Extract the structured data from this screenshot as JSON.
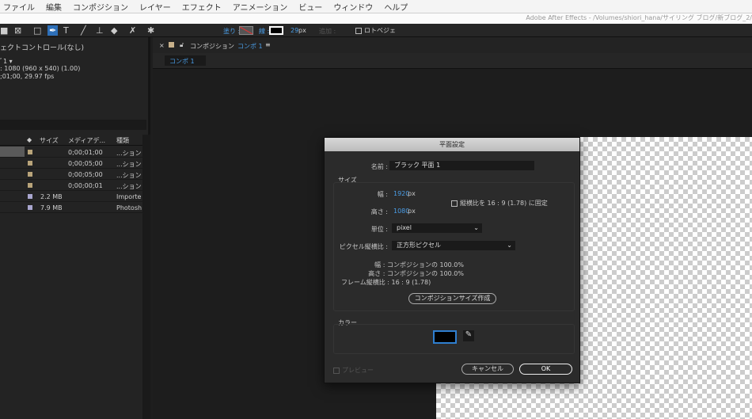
{
  "menu": [
    "ファイル",
    "編集",
    "コンポジション",
    "レイヤー",
    "エフェクト",
    "アニメーション",
    "ビュー",
    "ウィンドウ",
    "ヘルプ"
  ],
  "window_title": "Adobe After Effects - /Volumes/shiori_hana/サイリング ブログ/新ブログ_2/",
  "toolbar": {
    "fill_label": "塗り :",
    "stroke_label": "線 :",
    "stroke_width": "29",
    "stroke_unit": "px",
    "add_label": "追加 :",
    "rotobezier_label": "ロトベジェ"
  },
  "left_panel": {
    "title": "ェクトコントロール(なし)",
    "comp_name": "ﾞ1 ▾",
    "info1": ": 1080  (960 x 540) (1.00)",
    "info2": ";01;00, 29.97 fps",
    "columns": [
      "サイズ",
      "メディアデ...",
      "種類"
    ],
    "rows": [
      {
        "size": "",
        "dur": "0;00;01;00",
        "type": "...ション",
        "color": "#b9a47a"
      },
      {
        "size": "",
        "dur": "0;00;05;00",
        "type": "...ション",
        "color": "#b9a47a"
      },
      {
        "size": "",
        "dur": "0;00;05;00",
        "type": "...ション",
        "color": "#b9a47a"
      },
      {
        "size": "",
        "dur": "0;00;00;01",
        "type": "...ション",
        "color": "#b9a47a"
      },
      {
        "size": "2.2 MB",
        "dur": "",
        "type": "Importe",
        "color": "#a9a6cf"
      },
      {
        "size": "7.9 MB",
        "dur": "",
        "type": "Photosh",
        "color": "#a9a6cf"
      }
    ]
  },
  "comp_panel": {
    "close": "×",
    "label": "コンポジション",
    "comp": "コンポ 1",
    "menu": "≡",
    "tab": "コンポ 1"
  },
  "dialog": {
    "title": "平面設定",
    "name_label": "名前 :",
    "name_value": "ブラック 平面 1",
    "size_group": "サイズ",
    "width_label": "幅 :",
    "width_value": "1920",
    "height_label": "高さ :",
    "height_value": "1080",
    "px": "px",
    "lock_label": "縦横比を 16 : 9 (1.78) に固定",
    "unit_label": "単位 :",
    "unit_value": "pixel",
    "par_label": "ピクセル縦横比 :",
    "par_value": "正方形ピクセル",
    "info_w": "幅 : コンポジションの 100.0%",
    "info_h": "高さ : コンポジションの 100.0%",
    "info_f": "フレーム縦横比 : 16 : 9 (1.78)",
    "comp_size_btn": "コンポジションサイズ作成",
    "color_group": "カラー",
    "color_value": "#000000",
    "preview": "プレビュー",
    "cancel": "キャンセル",
    "ok": "OK"
  }
}
